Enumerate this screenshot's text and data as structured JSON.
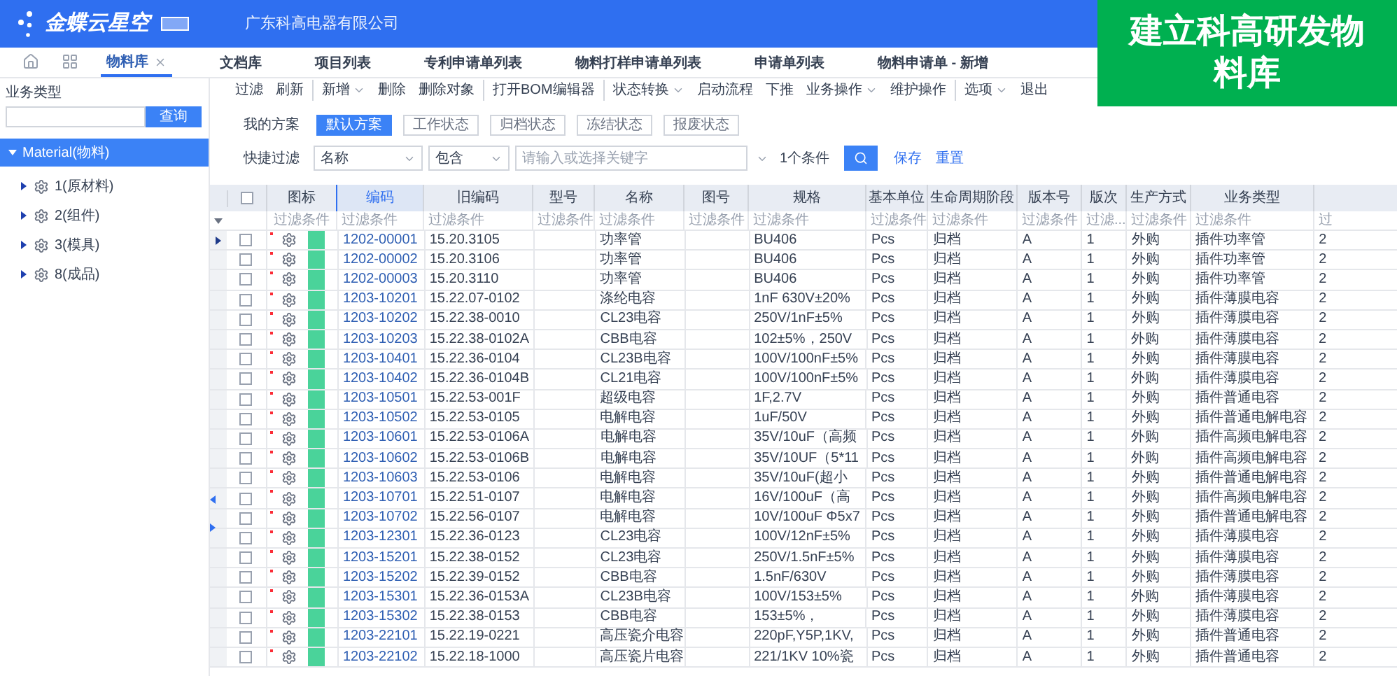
{
  "header": {
    "product": "金蝶云星空",
    "company": "广东科高电器有限公司"
  },
  "banner": {
    "text": "建立科高研发物料库"
  },
  "tabs": [
    {
      "label": "物料库",
      "selected": true,
      "closable": true
    },
    {
      "label": "文档库",
      "selected": false,
      "closable": false
    },
    {
      "label": "项目列表",
      "selected": false,
      "closable": false
    },
    {
      "label": "专利申请单列表",
      "selected": false,
      "closable": false
    },
    {
      "label": "物料打样申请单列表",
      "selected": false,
      "closable": false
    },
    {
      "label": "申请单列表",
      "selected": false,
      "closable": false
    },
    {
      "label": "物料申请单 - 新增",
      "selected": false,
      "closable": false
    }
  ],
  "sidebar": {
    "label": "业务类型",
    "search_button": "查询",
    "tree": [
      {
        "label": "Material(物料)",
        "selected": true,
        "expanded": true,
        "children": [
          {
            "label": "1(原材料)",
            "selected": false,
            "expanded": false
          },
          {
            "label": "2(组件)",
            "selected": false,
            "expanded": false
          },
          {
            "label": "3(模具)",
            "selected": false,
            "expanded": false
          },
          {
            "label": "8(成品)",
            "selected": false,
            "expanded": false
          }
        ]
      }
    ]
  },
  "toolbar": [
    [
      {
        "label": "过滤",
        "dropdown": false
      },
      {
        "label": "刷新",
        "dropdown": false
      }
    ],
    [
      {
        "label": "新增",
        "dropdown": true
      },
      {
        "label": "删除",
        "dropdown": false
      },
      {
        "label": "删除对象",
        "dropdown": false
      }
    ],
    [
      {
        "label": "打开BOM编辑器",
        "dropdown": false
      }
    ],
    [
      {
        "label": "状态转换",
        "dropdown": true
      },
      {
        "label": "启动流程",
        "dropdown": false
      },
      {
        "label": "下推",
        "dropdown": false
      },
      {
        "label": "业务操作",
        "dropdown": true
      },
      {
        "label": "维护操作",
        "dropdown": false
      }
    ],
    [
      {
        "label": "选项",
        "dropdown": true
      },
      {
        "label": "退出",
        "dropdown": false
      }
    ]
  ],
  "schemes": {
    "label": "我的方案",
    "items": [
      {
        "label": "默认方案",
        "selected": true
      },
      {
        "label": "工作状态",
        "selected": false
      },
      {
        "label": "归档状态",
        "selected": false
      },
      {
        "label": "冻结状态",
        "selected": false
      },
      {
        "label": "报废状态",
        "selected": false
      }
    ]
  },
  "quick_filter": {
    "label": "快捷过滤",
    "field": "名称",
    "operator": "包含",
    "placeholder": "请输入或选择关键字",
    "conditions": "1个条件",
    "save": "保存",
    "reset": "重置"
  },
  "table": {
    "all_checked": false,
    "columns": [
      {
        "label": "图标",
        "filter_hint": "过滤条件",
        "sorted": false
      },
      {
        "label": "编码",
        "filter_hint": "过滤条件",
        "sorted": true
      },
      {
        "label": "旧编码",
        "filter_hint": "过滤条件",
        "sorted": false
      },
      {
        "label": "型号",
        "filter_hint": "过滤条件",
        "sorted": false
      },
      {
        "label": "名称",
        "filter_hint": "过滤条件",
        "sorted": false
      },
      {
        "label": "图号",
        "filter_hint": "过滤条件",
        "sorted": false
      },
      {
        "label": "规格",
        "filter_hint": "过滤条件",
        "sorted": false
      },
      {
        "label": "基本单位",
        "filter_hint": "过滤条件",
        "sorted": false
      },
      {
        "label": "生命周期阶段",
        "filter_hint": "过滤条件",
        "sorted": false
      },
      {
        "label": "版本号",
        "filter_hint": "过滤条件",
        "sorted": false
      },
      {
        "label": "版次",
        "filter_hint": "过滤...",
        "sorted": false
      },
      {
        "label": "生产方式",
        "filter_hint": "过滤条件",
        "sorted": false
      },
      {
        "label": "业务类型",
        "filter_hint": "过滤条件",
        "sorted": false
      },
      {
        "filter_hint": "过",
        "sorted": false
      }
    ],
    "rows": [
      {
        "current": true,
        "checked": false,
        "code": "1202-00001",
        "old_code": "15.20.3105",
        "name": "功率管",
        "spec": "BU406",
        "unit": "Pcs",
        "lifecycle": "归档",
        "version": "A",
        "edition": "1",
        "production": "外购",
        "business_type": "插件功率管",
        "column_16": "2"
      },
      {
        "current": false,
        "checked": false,
        "code": "1202-00002",
        "old_code": "15.20.3106",
        "name": "功率管",
        "spec": "BU406",
        "unit": "Pcs",
        "lifecycle": "归档",
        "version": "A",
        "edition": "1",
        "production": "外购",
        "business_type": "插件功率管",
        "column_16": "2"
      },
      {
        "current": false,
        "checked": false,
        "code": "1202-00003",
        "old_code": "15.20.3110",
        "name": "功率管",
        "spec": "BU406",
        "unit": "Pcs",
        "lifecycle": "归档",
        "version": "A",
        "edition": "1",
        "production": "外购",
        "business_type": "插件功率管",
        "column_16": "2"
      },
      {
        "current": false,
        "checked": false,
        "code": "1203-10201",
        "old_code": "15.22.07-0102",
        "name": "涤纶电容",
        "spec": "1nF 630V±20%",
        "unit": "Pcs",
        "lifecycle": "归档",
        "version": "A",
        "edition": "1",
        "production": "外购",
        "business_type": "插件薄膜电容",
        "column_16": "2"
      },
      {
        "current": false,
        "checked": false,
        "code": "1203-10202",
        "old_code": "15.22.38-0010",
        "name": "CL23电容",
        "spec": "250V/1nF±5%",
        "unit": "Pcs",
        "lifecycle": "归档",
        "version": "A",
        "edition": "1",
        "production": "外购",
        "business_type": "插件薄膜电容",
        "column_16": "2"
      },
      {
        "current": false,
        "checked": false,
        "code": "1203-10203",
        "old_code": "15.22.38-0102A",
        "name": "CBB电容",
        "spec": "102±5%，250V",
        "unit": "Pcs",
        "lifecycle": "归档",
        "version": "A",
        "edition": "1",
        "production": "外购",
        "business_type": "插件薄膜电容",
        "column_16": "2"
      },
      {
        "current": false,
        "checked": false,
        "code": "1203-10401",
        "old_code": "15.22.36-0104",
        "name": "CL23B电容",
        "spec": "100V/100nF±5%",
        "unit": "Pcs",
        "lifecycle": "归档",
        "version": "A",
        "edition": "1",
        "production": "外购",
        "business_type": "插件薄膜电容",
        "column_16": "2"
      },
      {
        "current": false,
        "checked": false,
        "code": "1203-10402",
        "old_code": "15.22.36-0104B",
        "name": "CL21电容",
        "spec": "100V/100nF±5%",
        "unit": "Pcs",
        "lifecycle": "归档",
        "version": "A",
        "edition": "1",
        "production": "外购",
        "business_type": "插件薄膜电容",
        "column_16": "2"
      },
      {
        "current": false,
        "checked": false,
        "code": "1203-10501",
        "old_code": "15.22.53-001F",
        "name": "超级电容",
        "spec": "1F,2.7V",
        "unit": "Pcs",
        "lifecycle": "归档",
        "version": "A",
        "edition": "1",
        "production": "外购",
        "business_type": "插件普通电容",
        "column_16": "2"
      },
      {
        "current": false,
        "checked": false,
        "code": "1203-10502",
        "old_code": "15.22.53-0105",
        "name": "电解电容",
        "spec": "1uF/50V",
        "unit": "Pcs",
        "lifecycle": "归档",
        "version": "A",
        "edition": "1",
        "production": "外购",
        "business_type": "插件普通电解电容",
        "column_16": "2"
      },
      {
        "current": false,
        "checked": false,
        "code": "1203-10601",
        "old_code": "15.22.53-0106A",
        "name": "电解电容",
        "spec": "35V/10uF（高频",
        "unit": "Pcs",
        "lifecycle": "归档",
        "version": "A",
        "edition": "1",
        "production": "外购",
        "business_type": "插件高频电解电容",
        "column_16": "2"
      },
      {
        "current": false,
        "checked": false,
        "code": "1203-10602",
        "old_code": "15.22.53-0106B",
        "name": "电解电容",
        "spec": "35V/10UF（5*11",
        "unit": "Pcs",
        "lifecycle": "归档",
        "version": "A",
        "edition": "1",
        "production": "外购",
        "business_type": "插件高频电解电容",
        "column_16": "2"
      },
      {
        "current": false,
        "checked": false,
        "code": "1203-10603",
        "old_code": "15.22.53-0106",
        "name": "电解电容",
        "spec": "35V/10uF(超小",
        "unit": "Pcs",
        "lifecycle": "归档",
        "version": "A",
        "edition": "1",
        "production": "外购",
        "business_type": "插件普通电解电容",
        "column_16": "2"
      },
      {
        "current": false,
        "checked": false,
        "code": "1203-10701",
        "old_code": "15.22.51-0107",
        "name": "电解电容",
        "spec": "16V/100uF（高",
        "unit": "Pcs",
        "lifecycle": "归档",
        "version": "A",
        "edition": "1",
        "production": "外购",
        "business_type": "插件高频电解电容",
        "column_16": "2"
      },
      {
        "current": false,
        "checked": false,
        "code": "1203-10702",
        "old_code": "15.22.56-0107",
        "name": "电解电容",
        "spec": "10V/100uF Φ5x7",
        "unit": "Pcs",
        "lifecycle": "归档",
        "version": "A",
        "edition": "1",
        "production": "外购",
        "business_type": "插件普通电解电容",
        "column_16": "2"
      },
      {
        "current": false,
        "checked": false,
        "code": "1203-12301",
        "old_code": "15.22.36-0123",
        "name": "CL23电容",
        "spec": "100V/12nF±5%",
        "unit": "Pcs",
        "lifecycle": "归档",
        "version": "A",
        "edition": "1",
        "production": "外购",
        "business_type": "插件薄膜电容",
        "column_16": "2"
      },
      {
        "current": false,
        "checked": false,
        "code": "1203-15201",
        "old_code": "15.22.38-0152",
        "name": "CL23电容",
        "spec": "250V/1.5nF±5%",
        "unit": "Pcs",
        "lifecycle": "归档",
        "version": "A",
        "edition": "1",
        "production": "外购",
        "business_type": "插件薄膜电容",
        "column_16": "2"
      },
      {
        "current": false,
        "checked": false,
        "code": "1203-15202",
        "old_code": "15.22.39-0152",
        "name": "CBB电容",
        "spec": "1.5nF/630V",
        "unit": "Pcs",
        "lifecycle": "归档",
        "version": "A",
        "edition": "1",
        "production": "外购",
        "business_type": "插件薄膜电容",
        "column_16": "2"
      },
      {
        "current": false,
        "checked": false,
        "code": "1203-15301",
        "old_code": "15.22.36-0153A",
        "name": "CL23B电容",
        "spec": "100V/153±5%",
        "unit": "Pcs",
        "lifecycle": "归档",
        "version": "A",
        "edition": "1",
        "production": "外购",
        "business_type": "插件薄膜电容",
        "column_16": "2"
      },
      {
        "current": false,
        "checked": false,
        "code": "1203-15302",
        "old_code": "15.22.38-0153",
        "name": "CBB电容",
        "spec": "153±5%，",
        "unit": "Pcs",
        "lifecycle": "归档",
        "version": "A",
        "edition": "1",
        "production": "外购",
        "business_type": "插件薄膜电容",
        "column_16": "2"
      },
      {
        "current": false,
        "checked": false,
        "code": "1203-22101",
        "old_code": "15.22.19-0221",
        "name": "高压瓷介电容",
        "spec": "220pF,Y5P,1KV,",
        "unit": "Pcs",
        "lifecycle": "归档",
        "version": "A",
        "edition": "1",
        "production": "外购",
        "business_type": "插件普通电容",
        "column_16": "2"
      },
      {
        "current": false,
        "checked": false,
        "code": "1203-22102",
        "old_code": "15.22.18-1000",
        "name": "高压瓷片电容",
        "spec": "221/1KV 10%瓷",
        "unit": "Pcs",
        "lifecycle": "归档",
        "version": "A",
        "edition": "1",
        "production": "外购",
        "business_type": "插件普通电容",
        "column_16": "2"
      }
    ]
  }
}
